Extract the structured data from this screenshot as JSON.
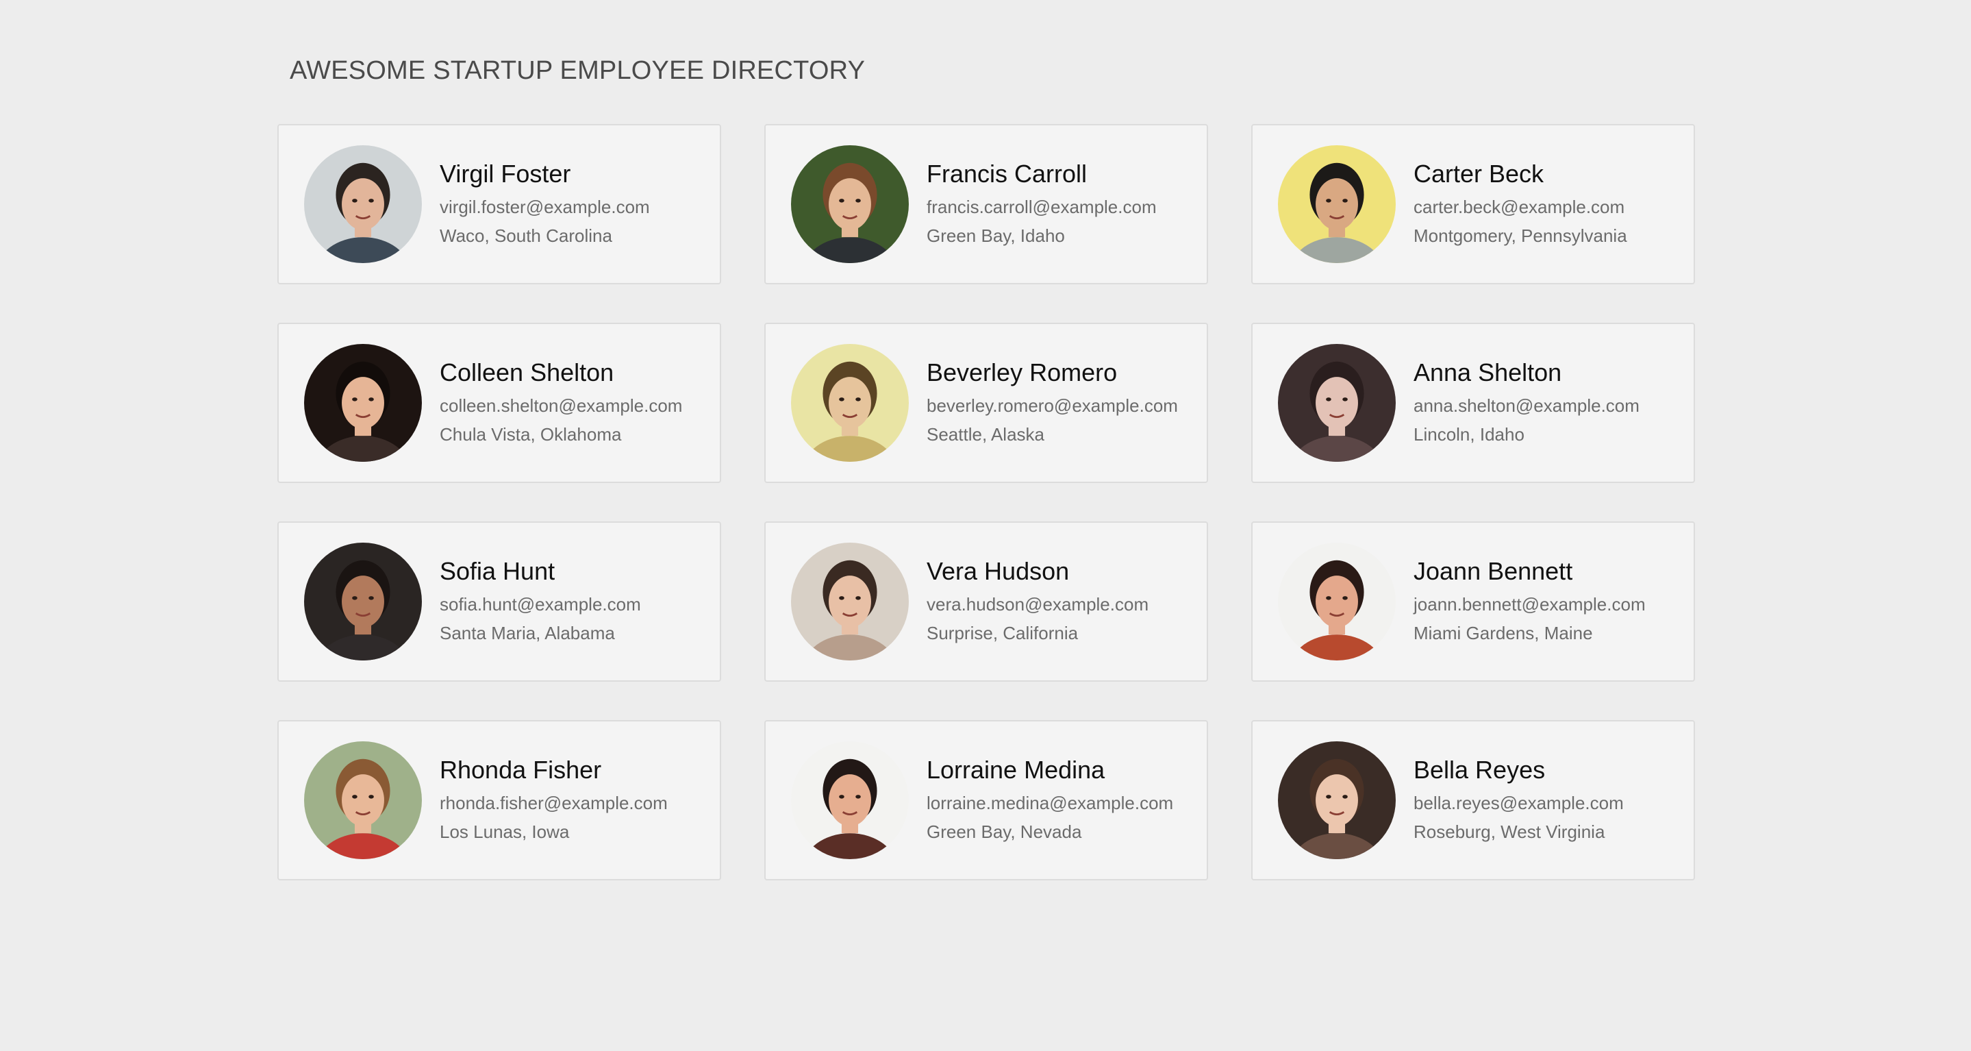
{
  "header": {
    "title": "AWESOME STARTUP EMPLOYEE DIRECTORY"
  },
  "employees": [
    {
      "name": "Virgil Foster",
      "email": "virgil.foster@example.com",
      "location": "Waco, South Carolina",
      "avatar": {
        "icon": "user-photo-icon",
        "bg": "#cfd4d6",
        "hair": "#2b2420",
        "skin": "#e2b59a",
        "shirt": "#3d4a57"
      }
    },
    {
      "name": "Francis Carroll",
      "email": "francis.carroll@example.com",
      "location": "Green Bay, Idaho",
      "avatar": {
        "icon": "user-photo-icon",
        "bg": "#3f5a2c",
        "hair": "#7a4a2c",
        "skin": "#e4b896",
        "shirt": "#2c3034"
      }
    },
    {
      "name": "Carter Beck",
      "email": "carter.beck@example.com",
      "location": "Montgomery, Pennsylvania",
      "avatar": {
        "icon": "user-photo-icon",
        "bg": "#efe27a",
        "hair": "#1c1a18",
        "skin": "#d9a882",
        "shirt": "#9ea6a0"
      }
    },
    {
      "name": "Colleen Shelton",
      "email": "colleen.shelton@example.com",
      "location": "Chula Vista, Oklahoma",
      "avatar": {
        "icon": "user-photo-icon",
        "bg": "#1d1411",
        "hair": "#120c0a",
        "skin": "#e6b596",
        "shirt": "#3a2c28"
      }
    },
    {
      "name": "Beverley Romero",
      "email": "beverley.romero@example.com",
      "location": "Seattle, Alaska",
      "avatar": {
        "icon": "user-photo-icon",
        "bg": "#e9e4a4",
        "hair": "#5b4424",
        "skin": "#e6c49c",
        "shirt": "#c8b26a"
      }
    },
    {
      "name": "Anna Shelton",
      "email": "anna.shelton@example.com",
      "location": "Lincoln, Idaho",
      "avatar": {
        "icon": "user-photo-icon",
        "bg": "#3c2e2e",
        "hair": "#2a1e1e",
        "skin": "#e3c2b6",
        "shirt": "#5b4646"
      }
    },
    {
      "name": "Sofia Hunt",
      "email": "sofia.hunt@example.com",
      "location": "Santa Maria, Alabama",
      "avatar": {
        "icon": "user-photo-icon",
        "bg": "#2a2523",
        "hair": "#1a1412",
        "skin": "#b27a5c",
        "shirt": "#2f2a2a"
      }
    },
    {
      "name": "Vera Hudson",
      "email": "vera.hudson@example.com",
      "location": "Surprise, California",
      "avatar": {
        "icon": "user-photo-icon",
        "bg": "#d8d0c6",
        "hair": "#3a2a22",
        "skin": "#e8c0a6",
        "shirt": "#b79e8c"
      }
    },
    {
      "name": "Joann Bennett",
      "email": "joann.bennett@example.com",
      "location": "Miami Gardens, Maine",
      "avatar": {
        "icon": "user-photo-icon",
        "bg": "#f2f2f0",
        "hair": "#2a1a16",
        "skin": "#e4a88c",
        "shirt": "#b84a2e"
      }
    },
    {
      "name": "Rhonda Fisher",
      "email": "rhonda.fisher@example.com",
      "location": "Los Lunas, Iowa",
      "avatar": {
        "icon": "user-photo-icon",
        "bg": "#9fb18a",
        "hair": "#8a5a34",
        "skin": "#e8b898",
        "shirt": "#c43a32"
      }
    },
    {
      "name": "Lorraine Medina",
      "email": "lorraine.medina@example.com",
      "location": "Green Bay, Nevada",
      "avatar": {
        "icon": "user-photo-icon",
        "bg": "#f3f3f1",
        "hair": "#221816",
        "skin": "#e6ae90",
        "shirt": "#5a2e26"
      }
    },
    {
      "name": "Bella Reyes",
      "email": "bella.reyes@example.com",
      "location": "Roseburg, West Virginia",
      "avatar": {
        "icon": "user-photo-icon",
        "bg": "#3a2c26",
        "hair": "#4a3226",
        "skin": "#ecc6ae",
        "shirt": "#6a4e42"
      }
    }
  ]
}
